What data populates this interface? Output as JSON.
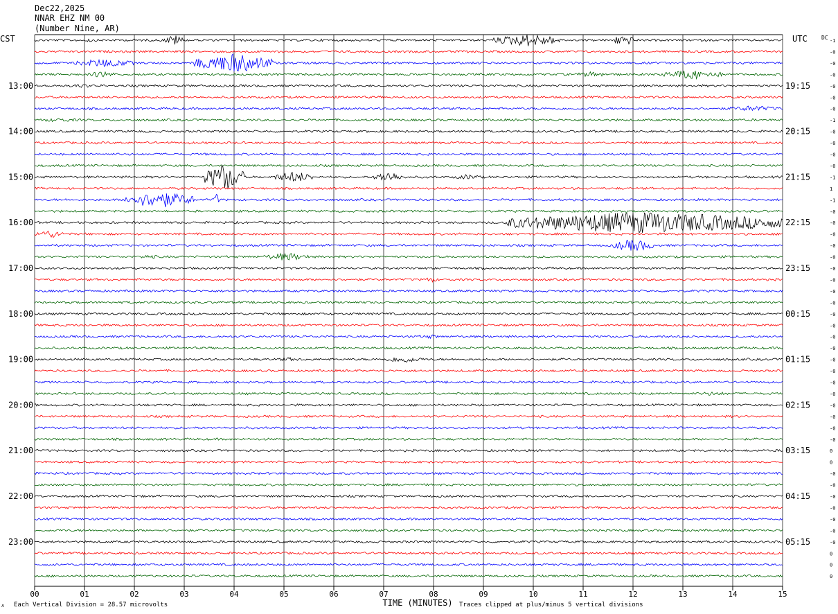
{
  "header": {
    "date": "Dec22,2025",
    "station": "NNAR EHZ NM 00",
    "location": "(Number Nine, AR)"
  },
  "left_zone_label": "CST",
  "right_zone_label": "UTC",
  "dc_label": "DC",
  "footer": {
    "vertical_division": "Each Vertical Division =   28.57 microvolts",
    "clip_note": "Traces clipped at plus/minus 5 vertical divisions"
  },
  "trace_colors": [
    "#000000",
    "#ff0000",
    "#0000ff",
    "#006400"
  ],
  "grid_color": "#000000",
  "chart_data": {
    "type": "line",
    "subtype": "helicorder",
    "xlabel": "TIME (MINUTES)",
    "xlim": [
      0,
      15
    ],
    "x_ticks": [
      "00",
      "01",
      "02",
      "03",
      "04",
      "05",
      "06",
      "07",
      "08",
      "09",
      "10",
      "11",
      "12",
      "13",
      "14",
      "15"
    ],
    "rows_per_hour": 4,
    "row_count": 48,
    "left_hour_labels": [
      {
        "row": 4,
        "label": "13:00"
      },
      {
        "row": 8,
        "label": "14:00"
      },
      {
        "row": 12,
        "label": "15:00"
      },
      {
        "row": 16,
        "label": "16:00"
      },
      {
        "row": 20,
        "label": "17:00"
      },
      {
        "row": 24,
        "label": "18:00"
      },
      {
        "row": 28,
        "label": "19:00"
      },
      {
        "row": 32,
        "label": "20:00"
      },
      {
        "row": 36,
        "label": "21:00"
      },
      {
        "row": 40,
        "label": "22:00"
      },
      {
        "row": 44,
        "label": "23:00"
      }
    ],
    "right_hour_labels": [
      {
        "row": 4,
        "label": "19:15"
      },
      {
        "row": 8,
        "label": "20:15"
      },
      {
        "row": 12,
        "label": "21:15"
      },
      {
        "row": 16,
        "label": "22:15"
      },
      {
        "row": 20,
        "label": "23:15"
      },
      {
        "row": 24,
        "label": "00:15"
      },
      {
        "row": 28,
        "label": "01:15"
      },
      {
        "row": 32,
        "label": "02:15"
      },
      {
        "row": 36,
        "label": "03:15"
      },
      {
        "row": 40,
        "label": "04:15"
      },
      {
        "row": 44,
        "label": "05:15"
      }
    ],
    "dc_offsets": [
      "-1",
      "-0",
      "-0",
      "-0",
      "-0",
      "-0",
      "-0",
      "-1",
      "-0",
      "-0",
      "-0",
      "-0",
      "-1",
      "1",
      "-1",
      "-0",
      "-0",
      "-0",
      "-0",
      "-0",
      "-0",
      "-0",
      "-0",
      "-0",
      "-0",
      "-0",
      "-0",
      "-0",
      "-0",
      "-0",
      "-0",
      "-0",
      "-0",
      "-0",
      "-0",
      "-0",
      "0",
      "0",
      "-0",
      "-0",
      "-0",
      "-0",
      "-0",
      "-0",
      "-0",
      "0",
      "0",
      "0"
    ],
    "events": [
      {
        "row": 0,
        "start_min": 2.6,
        "end_min": 3.0,
        "amp": 8
      },
      {
        "row": 0,
        "start_min": 1.0,
        "end_min": 1.2,
        "amp": 3
      },
      {
        "row": 0,
        "start_min": 9.2,
        "end_min": 10.6,
        "amp": 9
      },
      {
        "row": 0,
        "start_min": 11.6,
        "end_min": 12.0,
        "amp": 9
      },
      {
        "row": 2,
        "start_min": 0.8,
        "end_min": 2.0,
        "amp": 6
      },
      {
        "row": 2,
        "start_min": 3.2,
        "end_min": 4.8,
        "amp": 14
      },
      {
        "row": 3,
        "start_min": 1.1,
        "end_min": 1.6,
        "amp": 5
      },
      {
        "row": 3,
        "start_min": 10.8,
        "end_min": 11.6,
        "amp": 4
      },
      {
        "row": 3,
        "start_min": 12.6,
        "end_min": 13.8,
        "amp": 7
      },
      {
        "row": 4,
        "start_min": 0.7,
        "end_min": 1.2,
        "amp": 3
      },
      {
        "row": 6,
        "start_min": 13.8,
        "end_min": 15.0,
        "amp": 4
      },
      {
        "row": 7,
        "start_min": 0.0,
        "end_min": 1.0,
        "amp": 3
      },
      {
        "row": 12,
        "start_min": 3.4,
        "end_min": 4.2,
        "amp": 20
      },
      {
        "row": 12,
        "start_min": 4.8,
        "end_min": 5.6,
        "amp": 8
      },
      {
        "row": 12,
        "start_min": 6.8,
        "end_min": 7.4,
        "amp": 8
      },
      {
        "row": 12,
        "start_min": 8.4,
        "end_min": 9.0,
        "amp": 4
      },
      {
        "row": 14,
        "start_min": 1.8,
        "end_min": 3.2,
        "amp": 12
      },
      {
        "row": 14,
        "start_min": 3.6,
        "end_min": 3.7,
        "amp": 10
      },
      {
        "row": 16,
        "start_min": 9.4,
        "end_min": 15.0,
        "amp": 16
      },
      {
        "row": 17,
        "start_min": 0.0,
        "end_min": 0.6,
        "amp": 6
      },
      {
        "row": 18,
        "start_min": 11.6,
        "end_min": 12.4,
        "amp": 9
      },
      {
        "row": 19,
        "start_min": 2.0,
        "end_min": 2.6,
        "amp": 3
      },
      {
        "row": 19,
        "start_min": 4.6,
        "end_min": 5.5,
        "amp": 6
      },
      {
        "row": 21,
        "start_min": 7.8,
        "end_min": 8.1,
        "amp": 4
      },
      {
        "row": 26,
        "start_min": 7.6,
        "end_min": 8.2,
        "amp": 3
      },
      {
        "row": 28,
        "start_min": 7.0,
        "end_min": 7.8,
        "amp": 5
      },
      {
        "row": 28,
        "start_min": 4.8,
        "end_min": 5.4,
        "amp": 3
      },
      {
        "row": 31,
        "start_min": 13.2,
        "end_min": 14.0,
        "amp": 3
      },
      {
        "row": 33,
        "start_min": 13.6,
        "end_min": 14.4,
        "amp": 2
      }
    ]
  }
}
